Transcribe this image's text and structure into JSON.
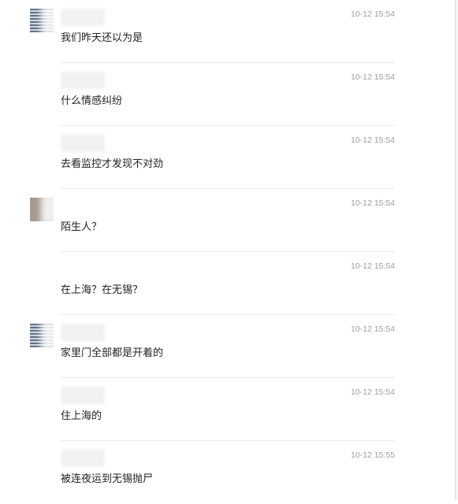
{
  "messages": [
    {
      "timestamp": "10-12 15:54",
      "text": "我们昨天还以为是",
      "avatar": "grid-avatar"
    },
    {
      "timestamp": "10-12 15:54",
      "text": "什么情感纠纷",
      "avatar": "none"
    },
    {
      "timestamp": "10-12 15:54",
      "text": "去看监控才发现不对劲",
      "avatar": "none"
    },
    {
      "timestamp": "10-12 15:54",
      "text": "陌生人？",
      "avatar": "photo-avatar"
    },
    {
      "timestamp": "10-12 15:54",
      "text": "在上海？在无锡？",
      "avatar": "none"
    },
    {
      "timestamp": "10-12 15:54",
      "text": "家里门全部都是开着的",
      "avatar": "grid-avatar"
    },
    {
      "timestamp": "10-12 15:54",
      "text": "住上海的",
      "avatar": "none"
    },
    {
      "timestamp": "10-12 15:55",
      "text": "被连夜运到无锡抛尸",
      "avatar": "none"
    }
  ]
}
